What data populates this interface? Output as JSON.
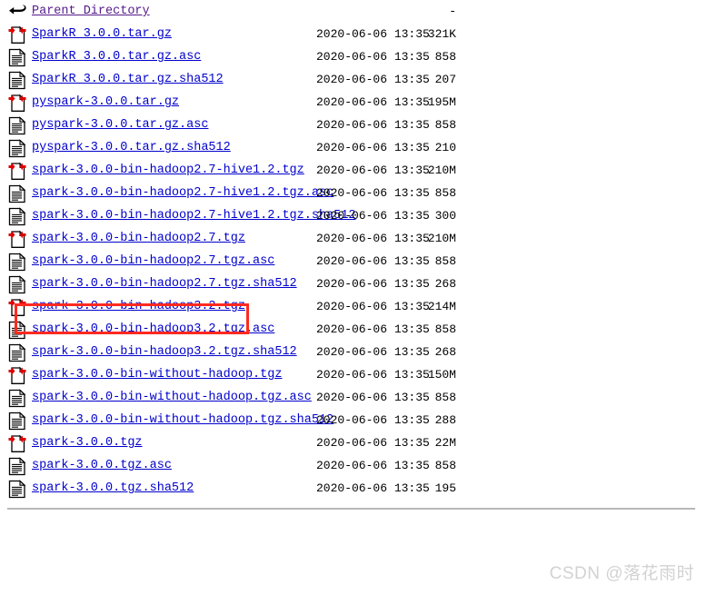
{
  "page": {
    "type": "apache-directory-index",
    "parent_label": "Parent Directory",
    "parent_size": "-",
    "link_color": "#0000cc",
    "visited_link_color": "#551a8b",
    "highlight_color": "#ff2a20",
    "watermark": "CSDN @落花雨时"
  },
  "rows": [
    {
      "icon": "back-arrow-icon",
      "name": "Parent Directory",
      "date": "",
      "size": "-"
    },
    {
      "icon": "compressed-file-icon",
      "name": "SparkR_3.0.0.tar.gz",
      "date": "2020-06-06 13:35",
      "size": "321K"
    },
    {
      "icon": "text-file-icon",
      "name": "SparkR_3.0.0.tar.gz.asc",
      "date": "2020-06-06 13:35",
      "size": "858"
    },
    {
      "icon": "text-file-icon",
      "name": "SparkR_3.0.0.tar.gz.sha512",
      "date": "2020-06-06 13:35",
      "size": "207"
    },
    {
      "icon": "compressed-file-icon",
      "name": "pyspark-3.0.0.tar.gz",
      "date": "2020-06-06 13:35",
      "size": "195M"
    },
    {
      "icon": "text-file-icon",
      "name": "pyspark-3.0.0.tar.gz.asc",
      "date": "2020-06-06 13:35",
      "size": "858"
    },
    {
      "icon": "text-file-icon",
      "name": "pyspark-3.0.0.tar.gz.sha512",
      "date": "2020-06-06 13:35",
      "size": "210"
    },
    {
      "icon": "compressed-file-icon",
      "name": "spark-3.0.0-bin-hadoop2.7-hive1.2.tgz",
      "date": "2020-06-06 13:35",
      "size": "210M"
    },
    {
      "icon": "text-file-icon",
      "name": "spark-3.0.0-bin-hadoop2.7-hive1.2.tgz.asc",
      "date": "2020-06-06 13:35",
      "size": "858"
    },
    {
      "icon": "text-file-icon",
      "name": "spark-3.0.0-bin-hadoop2.7-hive1.2.tgz.sha512",
      "date": "2020-06-06 13:35",
      "size": "300"
    },
    {
      "icon": "compressed-file-icon",
      "name": "spark-3.0.0-bin-hadoop2.7.tgz",
      "date": "2020-06-06 13:35",
      "size": "210M"
    },
    {
      "icon": "text-file-icon",
      "name": "spark-3.0.0-bin-hadoop2.7.tgz.asc",
      "date": "2020-06-06 13:35",
      "size": "858"
    },
    {
      "icon": "text-file-icon",
      "name": "spark-3.0.0-bin-hadoop2.7.tgz.sha512",
      "date": "2020-06-06 13:35",
      "size": "268"
    },
    {
      "icon": "compressed-file-icon",
      "name": "spark-3.0.0-bin-hadoop3.2.tgz",
      "date": "2020-06-06 13:35",
      "size": "214M"
    },
    {
      "icon": "text-file-icon",
      "name": "spark-3.0.0-bin-hadoop3.2.tgz.asc",
      "date": "2020-06-06 13:35",
      "size": "858"
    },
    {
      "icon": "text-file-icon",
      "name": "spark-3.0.0-bin-hadoop3.2.tgz.sha512",
      "date": "2020-06-06 13:35",
      "size": "268"
    },
    {
      "icon": "compressed-file-icon",
      "name": "spark-3.0.0-bin-without-hadoop.tgz",
      "date": "2020-06-06 13:35",
      "size": "150M"
    },
    {
      "icon": "text-file-icon",
      "name": "spark-3.0.0-bin-without-hadoop.tgz.asc",
      "date": "2020-06-06 13:35",
      "size": "858"
    },
    {
      "icon": "text-file-icon",
      "name": "spark-3.0.0-bin-without-hadoop.tgz.sha512",
      "date": "2020-06-06 13:35",
      "size": "288"
    },
    {
      "icon": "compressed-file-icon",
      "name": "spark-3.0.0.tgz",
      "date": "2020-06-06 13:35",
      "size": "22M"
    },
    {
      "icon": "text-file-icon",
      "name": "spark-3.0.0.tgz.asc",
      "date": "2020-06-06 13:35",
      "size": "858"
    },
    {
      "icon": "text-file-icon",
      "name": "spark-3.0.0.tgz.sha512",
      "date": "2020-06-06 13:35",
      "size": "195"
    }
  ]
}
